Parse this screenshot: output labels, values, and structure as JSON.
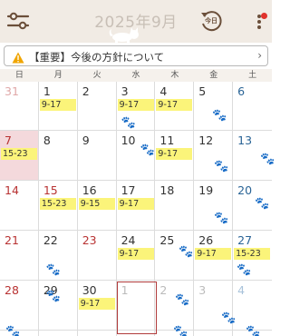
{
  "header": {
    "title": "2025年9月",
    "today_label": "今日"
  },
  "notice": {
    "text": "【重要】今後の方針について"
  },
  "weekdays": [
    "日",
    "月",
    "火",
    "水",
    "木",
    "金",
    "土"
  ],
  "days": [
    {
      "n": "31",
      "other": true
    },
    {
      "n": "1",
      "ev": "9-17"
    },
    {
      "n": "2"
    },
    {
      "n": "3",
      "ev": "9-17"
    },
    {
      "n": "4",
      "ev": "9-17"
    },
    {
      "n": "5"
    },
    {
      "n": "6"
    },
    {
      "n": "7",
      "ev": "15-23",
      "today": true
    },
    {
      "n": "8"
    },
    {
      "n": "9"
    },
    {
      "n": "10"
    },
    {
      "n": "11",
      "ev": "9-17"
    },
    {
      "n": "12"
    },
    {
      "n": "13"
    },
    {
      "n": "14"
    },
    {
      "n": "15",
      "ev": "15-23",
      "holiday": true
    },
    {
      "n": "16",
      "ev": "9-15"
    },
    {
      "n": "17",
      "ev": "9-17"
    },
    {
      "n": "18"
    },
    {
      "n": "19"
    },
    {
      "n": "20"
    },
    {
      "n": "21"
    },
    {
      "n": "22"
    },
    {
      "n": "23",
      "holiday": true
    },
    {
      "n": "24",
      "ev": "9-17"
    },
    {
      "n": "25"
    },
    {
      "n": "26",
      "ev": "9-17"
    },
    {
      "n": "27",
      "ev": "15-23"
    },
    {
      "n": "28"
    },
    {
      "n": "29"
    },
    {
      "n": "30",
      "ev": "9-17"
    },
    {
      "n": "1",
      "other": true,
      "selected": true
    },
    {
      "n": "2",
      "other": true
    },
    {
      "n": "3",
      "other": true
    },
    {
      "n": "4",
      "other": true
    },
    {
      "n": ""
    },
    {
      "n": ""
    },
    {
      "n": ""
    },
    {
      "n": ""
    },
    {
      "n": ""
    },
    {
      "n": ""
    },
    {
      "n": ""
    }
  ]
}
